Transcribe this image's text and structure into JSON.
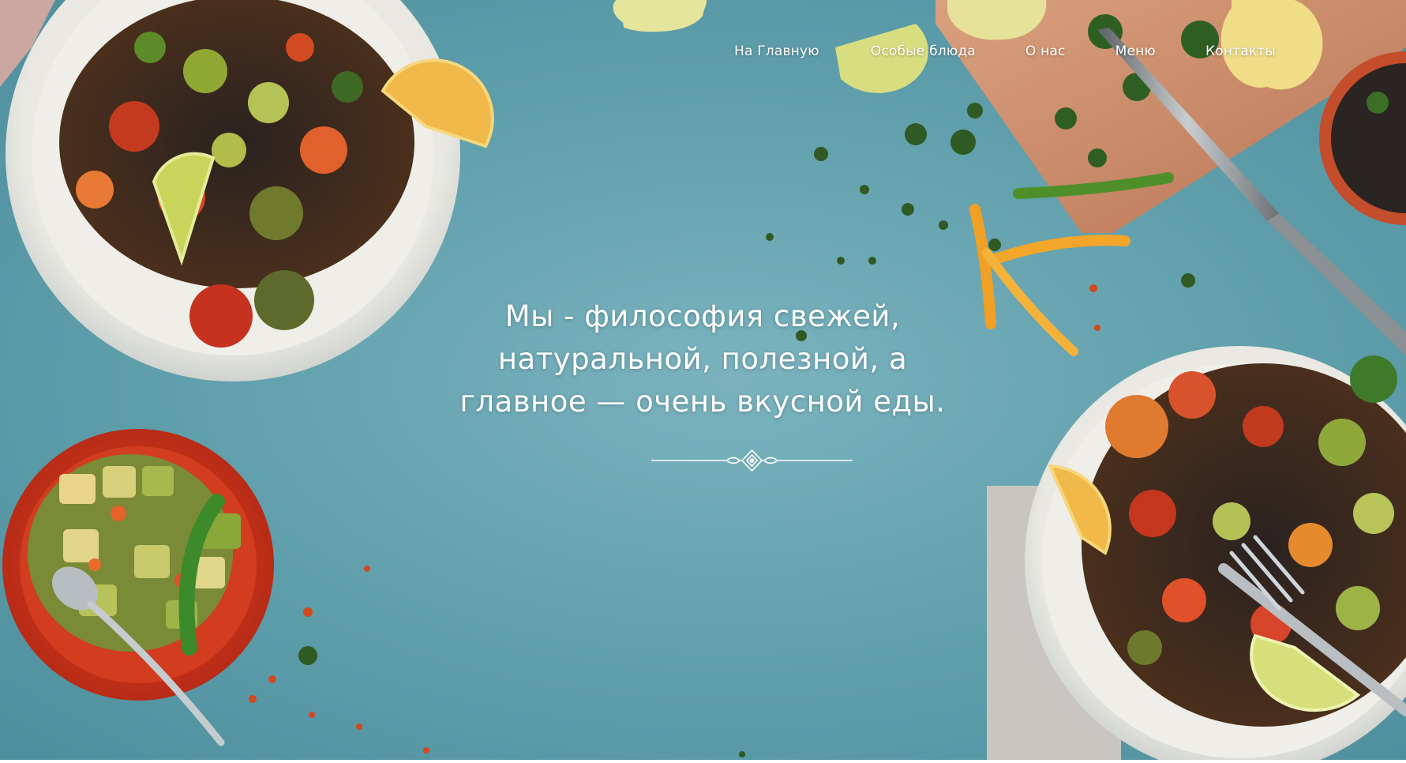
{
  "nav": {
    "items": [
      {
        "label": "На Главную"
      },
      {
        "label": "Особые блюда"
      },
      {
        "label": "О нас"
      },
      {
        "label": "Меню"
      },
      {
        "label": "Контакты"
      }
    ]
  },
  "hero": {
    "tagline_lines": [
      "Мы - философия свежей,",
      "натуральной, полезной, а",
      "главное — очень вкусной еды."
    ],
    "background_color": "#5f9eab",
    "text_color": "#ffffff"
  }
}
